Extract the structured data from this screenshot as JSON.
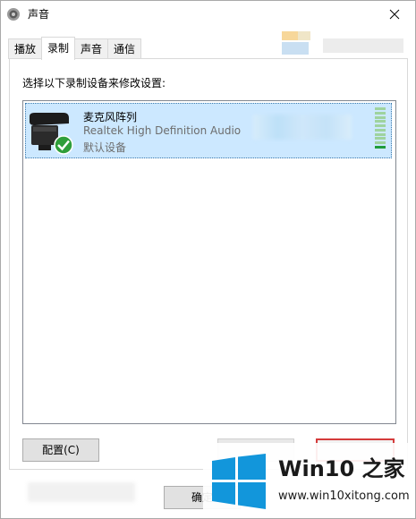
{
  "window": {
    "title": "声音"
  },
  "tabs": [
    {
      "label": "播放",
      "active": false
    },
    {
      "label": "录制",
      "active": true
    },
    {
      "label": "声音",
      "active": false
    },
    {
      "label": "通信",
      "active": false
    }
  ],
  "panel": {
    "instructions": "选择以下录制设备来修改设置:"
  },
  "device": {
    "name": "麦克风阵列",
    "driver": "Realtek High Definition Audio",
    "status": "默认设备",
    "level_fraction": 0.1
  },
  "buttons": {
    "configure": "配置(C)",
    "ok": "确定"
  },
  "watermark": {
    "title": "Win10 之家",
    "url": "www.win10xitong.com"
  },
  "colors": {
    "selection": "#cce8ff",
    "level_on": "#1f9c3a",
    "watermark_blue": "#1296db",
    "highlight_border": "#d43b3b"
  }
}
